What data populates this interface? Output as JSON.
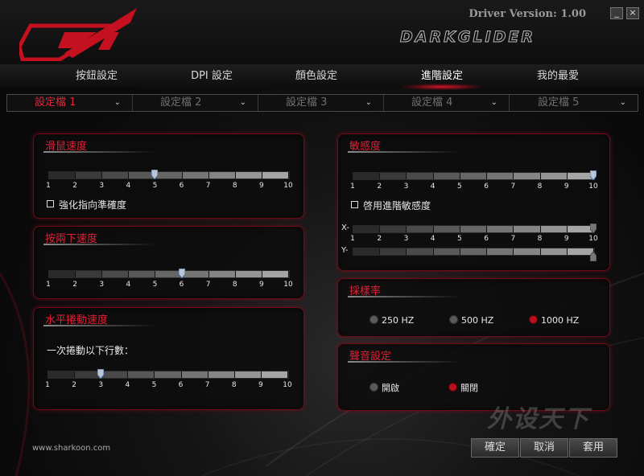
{
  "header": {
    "version": "Driver Version: 1.00",
    "brand": "DARKGLIDER",
    "minimize": "_",
    "close": "×"
  },
  "tabs": [
    {
      "label": "按鈕設定"
    },
    {
      "label": "DPI 設定"
    },
    {
      "label": "顏色設定"
    },
    {
      "label": "進階設定",
      "active": true
    },
    {
      "label": "我的最愛"
    }
  ],
  "profiles": [
    {
      "label": "設定檔 1",
      "active": true
    },
    {
      "label": "設定檔 2"
    },
    {
      "label": "設定檔 3"
    },
    {
      "label": "設定檔 4"
    },
    {
      "label": "設定檔 5"
    }
  ],
  "mouse_speed": {
    "title": "滑鼠速度",
    "ticks": [
      "1",
      "2",
      "3",
      "4",
      "5",
      "6",
      "7",
      "8",
      "9",
      "10"
    ],
    "value": 5,
    "checkbox": "強化指向準確度"
  },
  "double_click": {
    "title": "按兩下速度",
    "ticks": [
      "1",
      "2",
      "3",
      "4",
      "5",
      "6",
      "7",
      "8",
      "9",
      "10"
    ],
    "value": 6
  },
  "scroll": {
    "title": "水平捲動速度",
    "subtitle": "一次捲動以下行數：",
    "ticks": [
      "1",
      "2",
      "3",
      "4",
      "5",
      "6",
      "7",
      "8",
      "9",
      "10"
    ],
    "value": 3
  },
  "sensitivity": {
    "title": "敏感度",
    "ticks": [
      "1",
      "2",
      "3",
      "4",
      "5",
      "6",
      "7",
      "8",
      "9",
      "10"
    ],
    "value": 10,
    "checkbox": "啓用進階敏感度",
    "x_label": "X-",
    "y_label": "Y-",
    "x_value": 10,
    "y_value": 10
  },
  "sampling": {
    "title": "採樣率",
    "options": [
      "250 HZ",
      "500 HZ",
      "1000 HZ"
    ],
    "selected": "1000 HZ"
  },
  "sound": {
    "title": "聲音設定",
    "options": [
      "開啟",
      "關閉"
    ],
    "selected": "關閉"
  },
  "footer": {
    "site": "www.sharkoon.com",
    "ok": "確定",
    "cancel": "取消",
    "apply": "套用"
  },
  "watermark": "外设天下",
  "colors": {
    "accent": "#e02035",
    "panel_border": "#6a0d16",
    "active_radio": "#b8101e"
  }
}
